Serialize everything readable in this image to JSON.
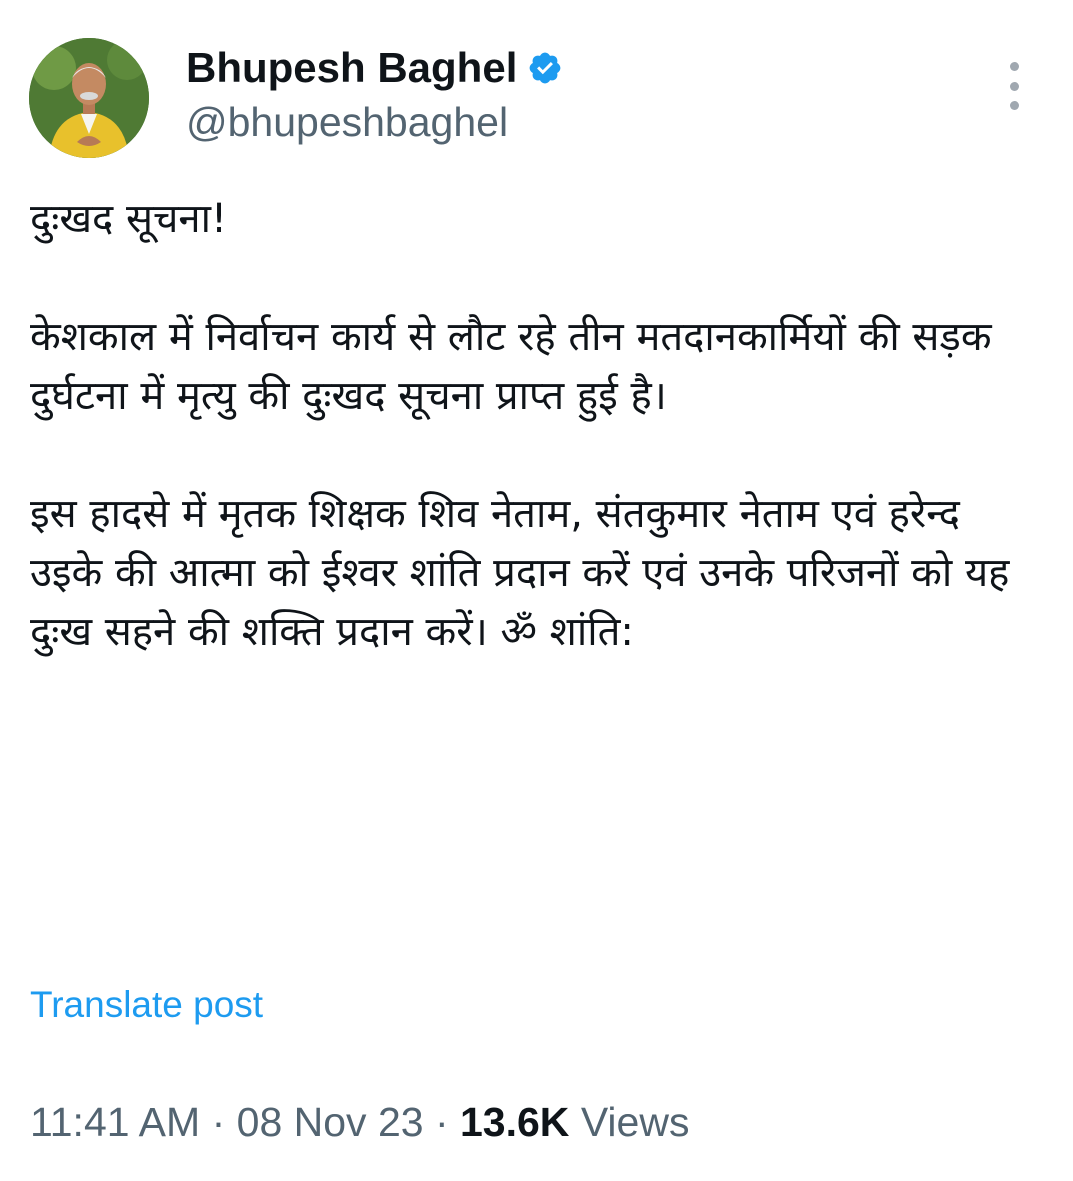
{
  "author": {
    "display_name": "Bhupesh Baghel",
    "handle": "@bhupeshbaghel",
    "verified": true
  },
  "post": {
    "paragraphs": [
      "दुःखद सूचना!",
      "केशकाल में निर्वाचन कार्य से लौट रहे तीन मतदानकार्मियों की सड़क दुर्घटना में मृत्यु की दुःखद सूचना प्राप्त हुई है।",
      "इस हादसे में मृतक शिक्षक शिव नेताम, संतकुमार नेताम एवं हरेन्द उइके की आत्मा को ईश्वर शांति प्रदान करें एवं उनके परिजनों को यह दुःख सहने की शक्ति प्रदान करें। ॐ शांति:"
    ],
    "translate_label": "Translate post",
    "time": "11:41 AM",
    "date": "08 Nov 23",
    "separator": "·",
    "views_count": "13.6K",
    "views_label": "Views"
  },
  "colors": {
    "accent": "#1d9bf0",
    "secondary_text": "#536471",
    "primary_text": "#0f1419"
  },
  "icons": {
    "verified": "verified-badge-icon",
    "more": "more-options-icon"
  }
}
